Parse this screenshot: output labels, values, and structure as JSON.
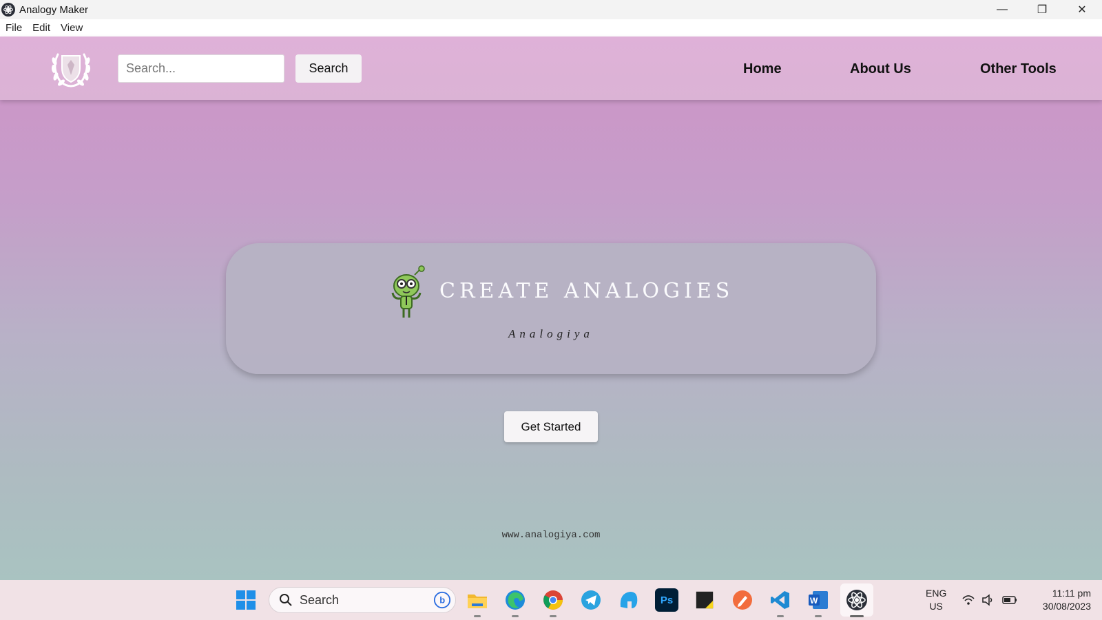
{
  "window": {
    "title": "Analogy Maker",
    "controls": {
      "minimize": "—",
      "restore": "❐",
      "close": "✕"
    }
  },
  "menu": [
    "File",
    "Edit",
    "View"
  ],
  "navbar": {
    "search_placeholder": "Search...",
    "search_button": "Search",
    "links": [
      "Home",
      "About Us",
      "Other Tools"
    ]
  },
  "hero": {
    "title": "CREATE ANALOGIES",
    "subtitle": "Analogiya"
  },
  "cta": {
    "label": "Get Started"
  },
  "footer": {
    "url": "www.analogiya.com"
  },
  "taskbar": {
    "search_label": "Search",
    "apps": [
      "windows-start",
      "file-explorer",
      "edge",
      "chrome",
      "telegram",
      "bluebird",
      "photoshop",
      "sticky-notes",
      "pen-app",
      "vscode",
      "word",
      "analogy-maker"
    ],
    "lang_primary": "ENG",
    "lang_secondary": "US",
    "time": "11:11 pm",
    "date": "30/08/2023"
  },
  "colors": {
    "gradient_top": "#cf93c8",
    "gradient_bottom": "#a9c3c1",
    "navbar": "#dfb1d8",
    "card": "#b6b2c4"
  }
}
